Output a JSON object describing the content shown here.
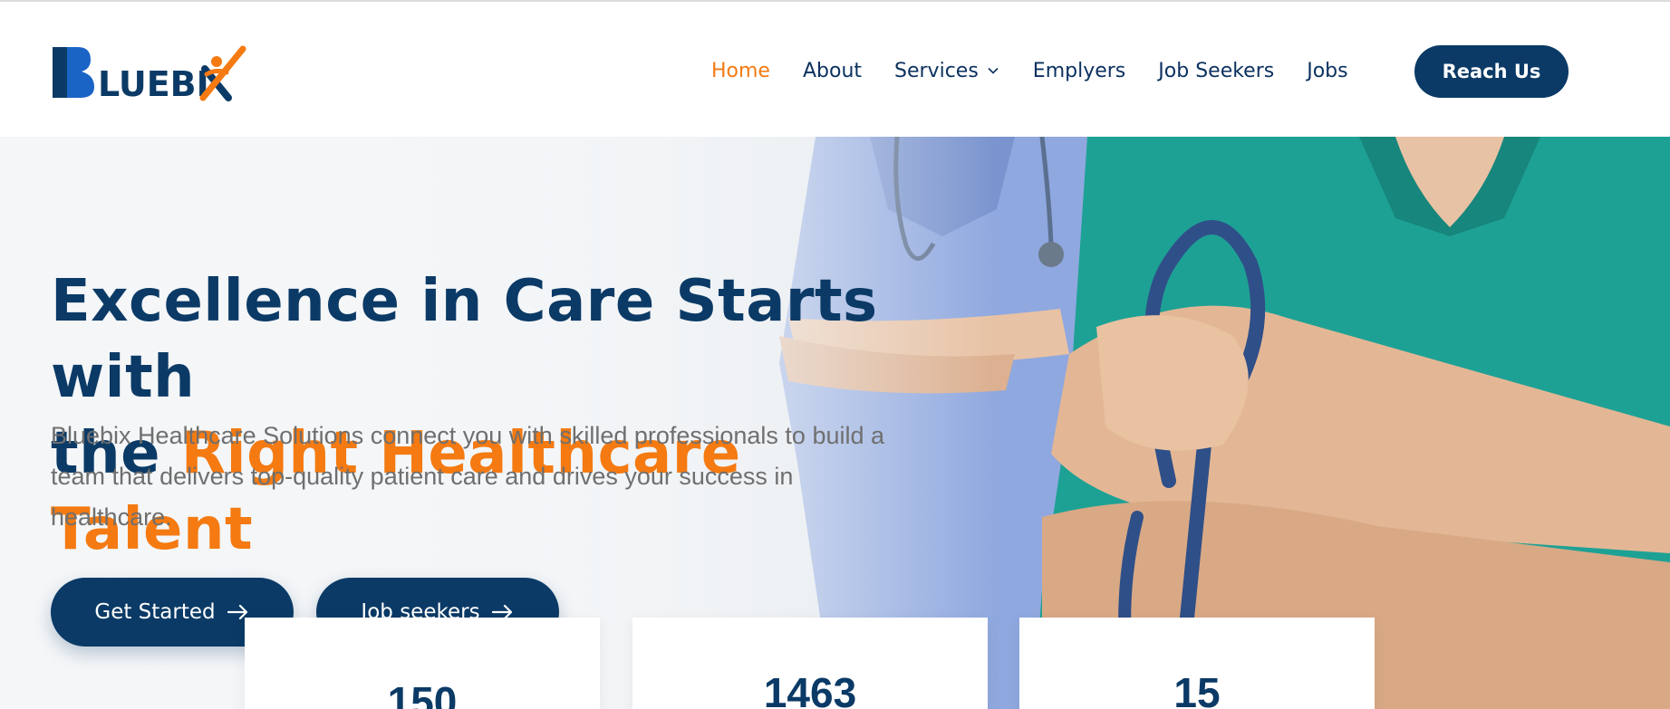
{
  "brand": {
    "name": "BLUEBIX",
    "colors": {
      "navy": "#0b3a66",
      "orange": "#f47a11",
      "nav_text": "#0c3260",
      "body_text": "#6f6f6f"
    }
  },
  "nav": {
    "items": [
      {
        "label": "Home",
        "active": true
      },
      {
        "label": "About",
        "active": false
      },
      {
        "label": "Services",
        "active": false,
        "has_dropdown": true
      },
      {
        "label": "Emplyers",
        "active": false
      },
      {
        "label": "Job Seekers",
        "active": false
      },
      {
        "label": "Jobs",
        "active": false
      }
    ],
    "cta": "Reach Us"
  },
  "hero": {
    "headline_part1": "Excellence in Care Starts with",
    "headline_part2": "the ",
    "headline_accent": "Right Healthcare Talent",
    "subtext": "Bluebix Healthcare Solutions connect you with skilled professionals to build a team that delivers top-quality patient care and drives your success in healthcare.",
    "buttons": {
      "get_started": "Get Started",
      "job_seekers": "Job seekers"
    }
  },
  "stats": [
    {
      "value": "150"
    },
    {
      "value": "1463"
    },
    {
      "value": "15"
    }
  ]
}
